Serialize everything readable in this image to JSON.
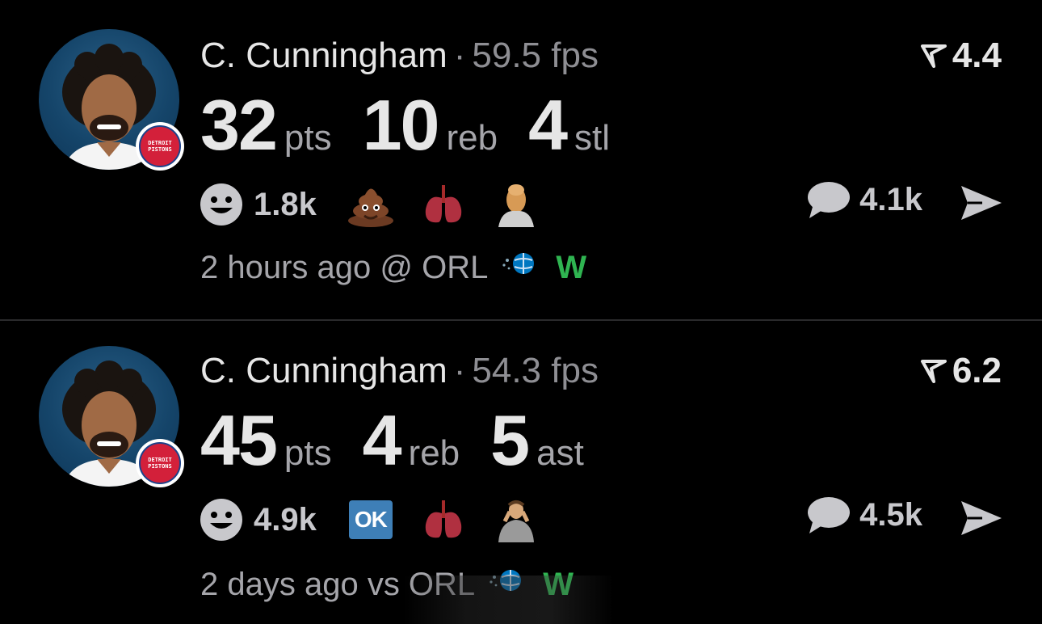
{
  "posts": [
    {
      "player": "C. Cunningham",
      "separator": "·",
      "fps": "59.5 fps",
      "rating": "4.4",
      "team_badge": [
        "DETROIT",
        "PISTONS"
      ],
      "stats": [
        {
          "value": "32",
          "unit": "pts"
        },
        {
          "value": "10",
          "unit": "reb"
        },
        {
          "value": "4",
          "unit": "stl"
        }
      ],
      "reaction_count": "1.8k",
      "reaction_icons": [
        "smiley-icon",
        "poop-emoji",
        "lungs-emoji",
        "masked-face-emoji"
      ],
      "comment_count": "4.1k",
      "time": "2 hours ago @ ORL",
      "result": "W",
      "result_color": "#2fb451"
    },
    {
      "player": "C. Cunningham",
      "separator": "·",
      "fps": "54.3 fps",
      "rating": "6.2",
      "team_badge": [
        "DETROIT",
        "PISTONS"
      ],
      "stats": [
        {
          "value": "45",
          "unit": "pts"
        },
        {
          "value": "4",
          "unit": "reb"
        },
        {
          "value": "5",
          "unit": "ast"
        }
      ],
      "reaction_count": "4.9k",
      "reaction_icons": [
        "smiley-icon",
        "ok-emoji",
        "lungs-emoji",
        "player-photo-emoji"
      ],
      "ok_label": "OK",
      "comment_count": "4.5k",
      "time": "2 days ago vs ORL",
      "result": "W",
      "result_color": "#2fb451"
    }
  ]
}
